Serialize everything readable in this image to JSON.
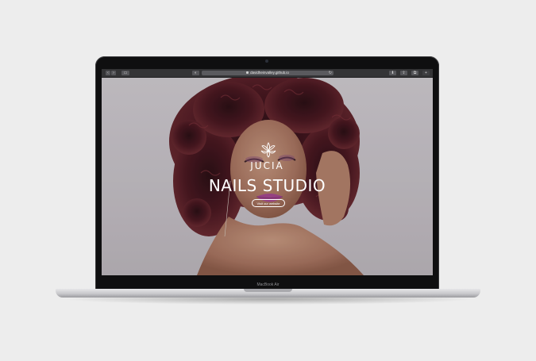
{
  "device": {
    "model_label": "MacBook Air"
  },
  "browser": {
    "url": "davidheinvalley.github.io",
    "buttons": {
      "back": "‹",
      "forward": "›",
      "sidebar": "▭",
      "shield": "◐",
      "download": "⬇",
      "share": "⇪",
      "tabs": "⧉"
    }
  },
  "hero": {
    "brand": "JUCIA",
    "title": "NAILS STUDIO",
    "cta_label": "Visit our website"
  },
  "colors": {
    "hair": "#4a1820",
    "lips": "#a4488f",
    "skin": "#b98970",
    "background": "#cfccd0",
    "text": "#ffffff"
  },
  "icons": {
    "logo": "lotus-icon",
    "secure": "lock-icon",
    "reload": "reload-icon"
  }
}
